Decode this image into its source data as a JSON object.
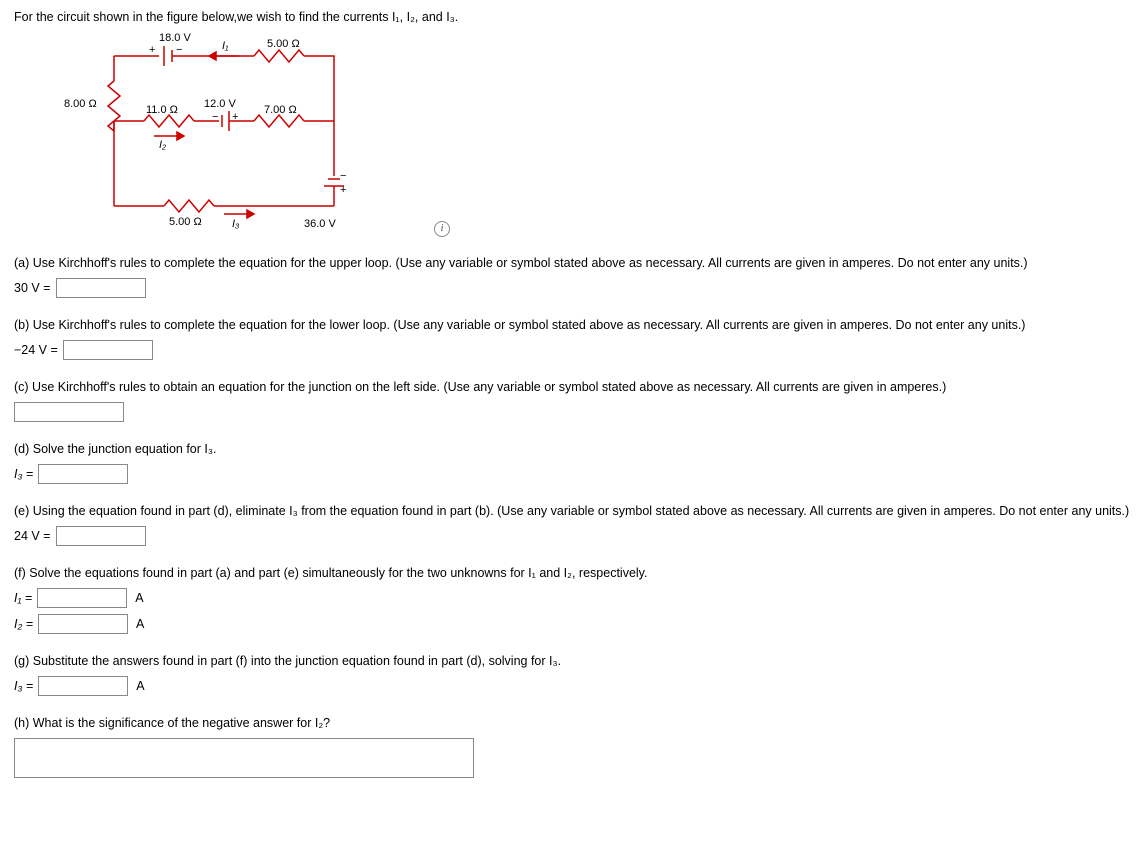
{
  "intro": "For the circuit shown in the figure below,we wish to find the currents I₁, I₂, and I₃.",
  "circuit": {
    "V_top": "18.0 V",
    "V_mid": "12.0 V",
    "V_bot": "36.0 V",
    "R_left": "8.00 Ω",
    "R_top": "5.00 Ω",
    "R_mid_left": "11.0 Ω",
    "R_mid_right": "7.00 Ω",
    "R_bot": "5.00 Ω",
    "I1": "I₁",
    "I2": "I₂",
    "I3": "I₃",
    "plus": "+",
    "minus": "−"
  },
  "parts": {
    "a": {
      "prompt": "(a) Use Kirchhoff's rules to complete the equation for the upper loop. (Use any variable or symbol stated above as necessary. All currents are given in amperes. Do not enter any units.)",
      "lhs": "30 V ="
    },
    "b": {
      "prompt": "(b) Use Kirchhoff's rules to complete the equation for the lower loop. (Use any variable or symbol stated above as necessary. All currents are given in amperes. Do not enter any units.)",
      "lhs": "−24 V ="
    },
    "c": {
      "prompt": "(c) Use Kirchhoff's rules to obtain an equation for the junction on the left side. (Use any variable or symbol stated above as necessary. All currents are given in amperes.)"
    },
    "d": {
      "prompt": "(d) Solve the junction equation for I₃.",
      "lhs": "I₃ ="
    },
    "e": {
      "prompt": "(e) Using the equation found in part (d), eliminate I₃ from the equation found in part (b). (Use any variable or symbol stated above as necessary. All currents are given in amperes. Do not enter any units.)",
      "lhs": "24 V ="
    },
    "f": {
      "prompt": "(f) Solve the equations found in part (a) and part (e) simultaneously for the two unknowns for I₁ and I₂, respectively.",
      "lhs1": "I₁ =",
      "lhs2": "I₂ =",
      "unit": "A"
    },
    "g": {
      "prompt": "(g) Substitute the answers found in part (f) into the junction equation found in part (d), solving for I₃.",
      "lhs": "I₃ =",
      "unit": "A"
    },
    "h": {
      "prompt": "(h) What is the significance of the negative answer for I₂?"
    }
  }
}
